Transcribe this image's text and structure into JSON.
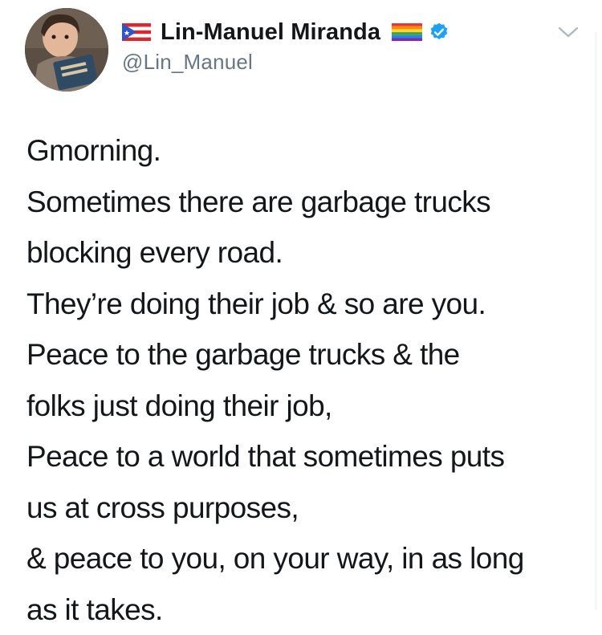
{
  "author": {
    "display_name": "Lin-Manuel Miranda",
    "handle": "@Lin_Manuel",
    "avatar_icon": "profile-photo",
    "flag_icon": "puerto-rico-flag-icon",
    "pride_icon": "rainbow-flag-icon",
    "verified_icon": "verified-badge-icon",
    "verified_color": "#1da1f2"
  },
  "menu": {
    "icon": "chevron-down-icon"
  },
  "tweet": {
    "lines": [
      "Gmorning.",
      "Sometimes there are garbage trucks",
      "blocking every road.",
      "They’re doing their job & so are you.",
      "Peace to the garbage trucks & the",
      "folks just doing their job,",
      "Peace to a world that sometimes puts",
      "us at cross purposes,",
      "& peace to you, on your way, in as long",
      "as it takes."
    ]
  }
}
